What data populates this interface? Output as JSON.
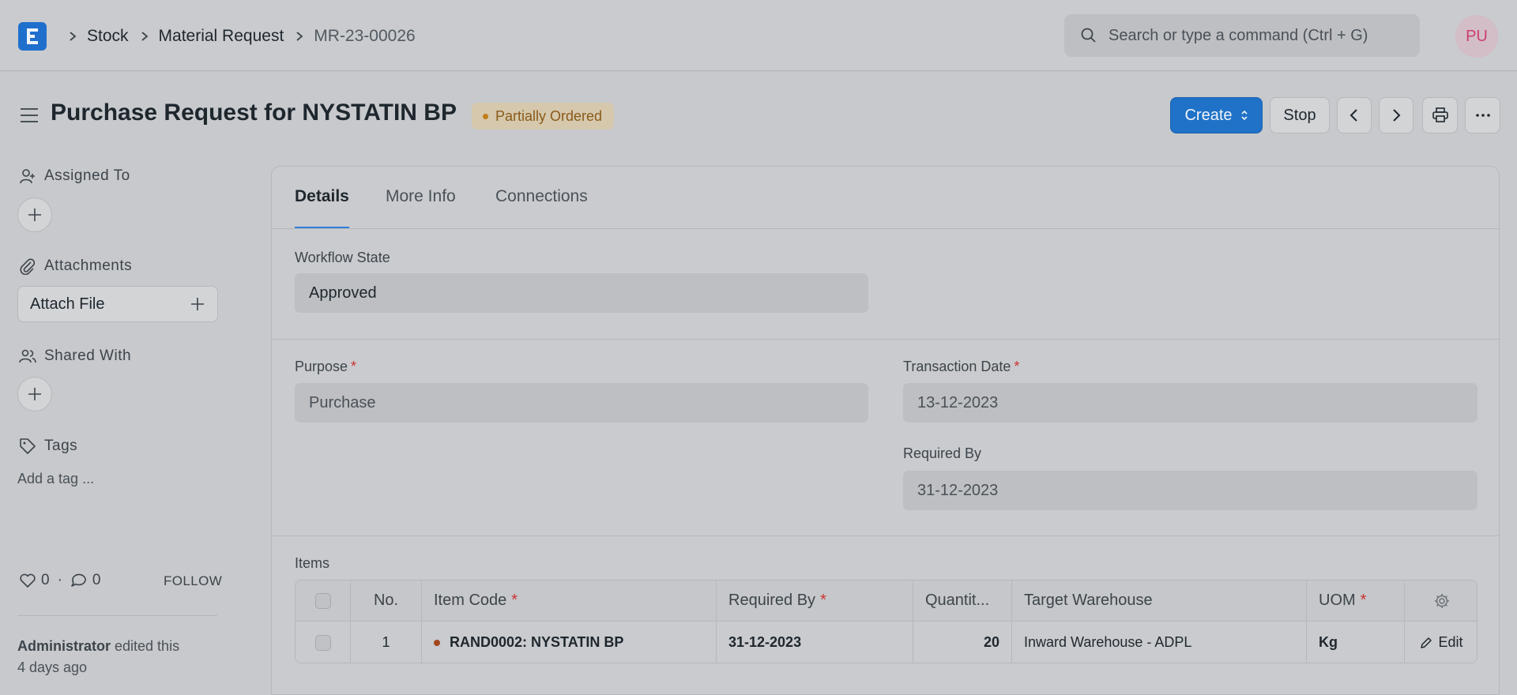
{
  "navbar": {
    "logo_letter": "E",
    "breadcrumb": [
      "Stock",
      "Material Request",
      "MR-23-00026"
    ],
    "search_placeholder": "Search or type a command (Ctrl + G)",
    "avatar_initials": "PU"
  },
  "page": {
    "title": "Purchase Request for NYSTATIN BP",
    "status": "Partially Ordered",
    "status_color": "#c27d16"
  },
  "actions": {
    "create": "Create",
    "stop": "Stop"
  },
  "sidebar": {
    "assigned_to": "Assigned To",
    "attachments": "Attachments",
    "attach_file": "Attach File",
    "shared_with": "Shared With",
    "tags": "Tags",
    "add_tag": "Add a tag ...",
    "likes": "0",
    "comments": "0",
    "dot": "·",
    "follow": "FOLLOW",
    "activity_user": "Administrator",
    "activity_text": " edited this",
    "activity_time": "4 days ago"
  },
  "tabs": [
    "Details",
    "More Info",
    "Connections"
  ],
  "form": {
    "workflow_state_label": "Workflow State",
    "workflow_state": "Approved",
    "purpose_label": "Purpose",
    "purpose": "Purchase",
    "transaction_date_label": "Transaction Date",
    "transaction_date": "13-12-2023",
    "required_by_label": "Required By",
    "required_by": "31-12-2023",
    "required_marker": "*"
  },
  "items": {
    "label": "Items",
    "columns": [
      "No.",
      "Item Code",
      "Required By",
      "Quantit...",
      "Target Warehouse",
      "UOM"
    ],
    "rows": [
      {
        "no": "1",
        "item_code": "RAND0002: NYSTATIN BP",
        "required_by": "31-12-2023",
        "quantity": "20",
        "target_warehouse": "Inward Warehouse - ADPL",
        "uom": "Kg",
        "edit": "Edit"
      }
    ]
  },
  "colors": {
    "primary": "#1f72c7",
    "required": "#cc3333",
    "avatar_text": "#cc3f70"
  }
}
